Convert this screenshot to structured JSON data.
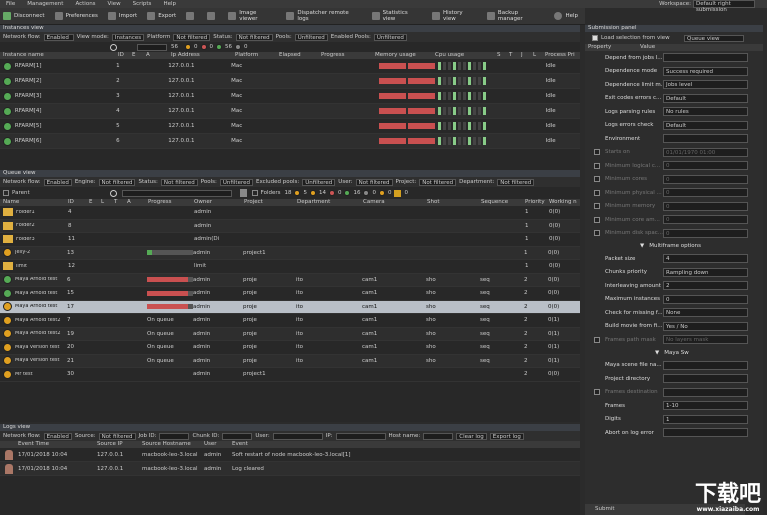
{
  "menu": [
    "File",
    "Management",
    "Actions",
    "View",
    "Scripts",
    "Help"
  ],
  "workspace": {
    "label": "Workspace:",
    "value": "Default right submission"
  },
  "toolbar": [
    "Disconnect",
    "Preferences",
    "Import",
    "Export",
    "",
    "",
    "Image viewer",
    "Dispatcher remote logs",
    "Statistics view",
    "History view",
    "Backup manager",
    "Help"
  ],
  "instances": {
    "title": "Instances view",
    "filter": {
      "network": "Network flow:",
      "network_val": "Enabled",
      "viewmode": "View mode:",
      "viewmode_val": "Instances",
      "platform": "Platform",
      "platform_val": "Not filtered",
      "status": "Status:",
      "status_val": "Not filtered",
      "pools": "Pools:",
      "pools_val": "Unfiltered",
      "enabled_pools": "Enabled Pools:",
      "enabled_val": "Unfiltered"
    },
    "counts": [
      "56",
      "0",
      "0",
      "56",
      "0"
    ],
    "headers": [
      "Instance name",
      "ID",
      "E",
      "A",
      "Ip Address",
      "Platform",
      "Elapsed",
      "Progress",
      "Memory usage",
      "Cpu usage",
      "S",
      "T",
      "J",
      "L",
      "Process Pri"
    ],
    "rows": [
      {
        "name": "RFARM[1]",
        "id": "1",
        "ip": "127.0.0.1",
        "platform": "Mac",
        "prio": "Idle"
      },
      {
        "name": "RFARM[2]",
        "id": "2",
        "ip": "127.0.0.1",
        "platform": "Mac",
        "prio": "Idle"
      },
      {
        "name": "RFARM[3]",
        "id": "3",
        "ip": "127.0.0.1",
        "platform": "Mac",
        "prio": "Idle"
      },
      {
        "name": "RFARM[4]",
        "id": "4",
        "ip": "127.0.0.1",
        "platform": "Mac",
        "prio": "Idle"
      },
      {
        "name": "RFARM[5]",
        "id": "5",
        "ip": "127.0.0.1",
        "platform": "Mac",
        "prio": "Idle"
      },
      {
        "name": "RFARM[6]",
        "id": "6",
        "ip": "127.0.0.1",
        "platform": "Mac",
        "prio": "Idle"
      }
    ]
  },
  "queue": {
    "title": "Queue view",
    "filter": {
      "network": "Network flow:",
      "network_val": "Enabled",
      "engine": "Engine:",
      "engine_val": "Not filtered",
      "status": "Status:",
      "status_val": "Not filtered",
      "pools": "Pools:",
      "pools_val": "Unfiltered",
      "excl": "Excluded pools:",
      "excl_val": "Unfiltered",
      "user": "User:",
      "user_val": "Not filtered",
      "project": "Project:",
      "project_val": "Not filtered",
      "dept": "Department:",
      "dept_val": "Not filtered"
    },
    "parent": "Parent",
    "folders": "Folders",
    "counts": [
      "18",
      "5",
      "14",
      "0",
      "16",
      "0",
      "0",
      "0"
    ],
    "headers": [
      "Name",
      "ID",
      "E",
      "L",
      "T",
      "A",
      "Progress",
      "Owner",
      "Project",
      "Department",
      "Camera",
      "Shot",
      "Sequence",
      "Priority",
      "Working n"
    ],
    "rows": [
      {
        "name": "Folder1",
        "id": "4",
        "progress": "",
        "owner": "admin",
        "project": "",
        "dept": "",
        "camera": "",
        "shot": "",
        "seq": "",
        "prio": "1",
        "work": "0(0)"
      },
      {
        "name": "Folder2",
        "id": "8",
        "progress": "",
        "owner": "admin",
        "project": "",
        "dept": "",
        "camera": "",
        "shot": "",
        "seq": "",
        "prio": "1",
        "work": "0(0)"
      },
      {
        "name": "Folder3",
        "id": "11",
        "progress": "",
        "owner": "admin(Di",
        "project": "",
        "dept": "",
        "camera": "",
        "shot": "",
        "seq": "",
        "prio": "1",
        "work": "0(0)"
      },
      {
        "name": "Jelly-2",
        "id": "13",
        "progress": "",
        "owner": "admin",
        "project": "project1",
        "dept": "",
        "camera": "",
        "shot": "",
        "seq": "",
        "prio": "1",
        "work": "0(0)"
      },
      {
        "name": "limit",
        "id": "12",
        "progress": "",
        "owner": "limit",
        "project": "",
        "dept": "",
        "camera": "",
        "shot": "",
        "seq": "",
        "prio": "1",
        "work": "0(0)"
      },
      {
        "name": "Maya Arnold test",
        "id": "6",
        "progress": "",
        "owner": "admin",
        "project": "proje",
        "dept": "ito",
        "camera": "cam1",
        "shot": "sho",
        "seq": "seq",
        "prio": "2",
        "work": "0(0)"
      },
      {
        "name": "Maya Arnold test",
        "id": "15",
        "progress": "",
        "owner": "admin",
        "project": "proje",
        "dept": "ito",
        "camera": "cam1",
        "shot": "sho",
        "seq": "seq",
        "prio": "2",
        "work": "0(0)"
      },
      {
        "name": "Maya Arnold test",
        "id": "17",
        "progress": "",
        "owner": "admin",
        "project": "proje",
        "dept": "ito",
        "camera": "cam1",
        "shot": "sho",
        "seq": "seq",
        "prio": "2",
        "work": "0(0)"
      },
      {
        "name": "Maya Arnold test2",
        "id": "7",
        "progress": "On queue",
        "owner": "admin",
        "project": "proje",
        "dept": "ito",
        "camera": "cam1",
        "shot": "sho",
        "seq": "seq",
        "prio": "2",
        "work": "0(1)"
      },
      {
        "name": "Maya Arnold test2",
        "id": "19",
        "progress": "On queue",
        "owner": "admin",
        "project": "proje",
        "dept": "ito",
        "camera": "cam1",
        "shot": "sho",
        "seq": "seq",
        "prio": "2",
        "work": "0(1)"
      },
      {
        "name": "Maya version test",
        "id": "20",
        "progress": "On queue",
        "owner": "admin",
        "project": "proje",
        "dept": "ito",
        "camera": "cam1",
        "shot": "sho",
        "seq": "seq",
        "prio": "2",
        "work": "0(1)"
      },
      {
        "name": "Maya version test",
        "id": "21",
        "progress": "On queue",
        "owner": "admin",
        "project": "proje",
        "dept": "ito",
        "camera": "cam1",
        "shot": "sho",
        "seq": "seq",
        "prio": "2",
        "work": "0(1)"
      },
      {
        "name": "Mr test",
        "id": "30",
        "progress": "",
        "owner": "admin",
        "project": "project1",
        "dept": "",
        "camera": "",
        "shot": "",
        "seq": "",
        "prio": "2",
        "work": "0(0)"
      }
    ]
  },
  "logs": {
    "title": "Logs view",
    "filter": {
      "network": "Network flow:",
      "network_val": "Enabled",
      "source": "Source:",
      "source_val": "Not filtered",
      "job": "Job ID:",
      "chunk": "Chunk ID:",
      "user": "User:",
      "ip": "IP:",
      "host": "Host name:",
      "clear": "Clear log",
      "export": "Export log"
    },
    "headers": [
      "Event Time",
      "Source IP",
      "Source Hostname",
      "User",
      "Event"
    ],
    "rows": [
      {
        "time": "17/01/2018 10:04",
        "ip": "127.0.0.1",
        "host": "macbook-leo-3.local",
        "user": "admin",
        "event": "Soft restart of node macbook-leo-3.local[1]"
      },
      {
        "time": "17/01/2018 10:04",
        "ip": "127.0.0.1",
        "host": "macbook-leo-3.local",
        "user": "admin",
        "event": "Log cleared"
      }
    ]
  },
  "submission": {
    "title": "Submission panel",
    "load": "Load selection from view",
    "load_val": "Queue view",
    "cols": [
      "Property",
      "Value"
    ],
    "rows": [
      {
        "label": "Depend from jobs l...",
        "value": ""
      },
      {
        "label": "Dependence mode",
        "value": "Success required"
      },
      {
        "label": "Dependence limit m...",
        "value": "Jobs level"
      },
      {
        "label": "Exit codes errors c...",
        "value": "Default"
      },
      {
        "label": "Logs parsing rules",
        "value": "No rules"
      },
      {
        "label": "Logs errors check",
        "value": "Default"
      },
      {
        "label": "Environment",
        "value": ""
      },
      {
        "label": "Starts on",
        "value": "01/01/1970 01:00"
      },
      {
        "label": "Minimum logical c...",
        "value": "0"
      },
      {
        "label": "Minimum cores",
        "value": "0"
      },
      {
        "label": "Minimum physical ...",
        "value": "0"
      },
      {
        "label": "Minimum memory",
        "value": "0"
      },
      {
        "label": "Minimum core am...",
        "value": "0"
      },
      {
        "label": "Minimum disk spac...",
        "value": "0"
      }
    ],
    "multiframe": "Multiframe options",
    "mrows": [
      {
        "label": "Packet size",
        "value": "4"
      },
      {
        "label": "Chunks priority",
        "value": "Rampling down"
      },
      {
        "label": "Interleaving amount",
        "value": "2"
      },
      {
        "label": "Maximum instances",
        "value": "0"
      },
      {
        "label": "Check for missing f...",
        "value": "None"
      },
      {
        "label": "Build movie from fi...",
        "value": "Yes / No"
      },
      {
        "label": "Frames path mask",
        "value": "No layers mask"
      }
    ],
    "maya": "Maya Sw",
    "yrows": [
      {
        "label": "Maya scene file na...",
        "value": ""
      },
      {
        "label": "Project directory",
        "value": ""
      },
      {
        "label": "Frames destination",
        "value": ""
      },
      {
        "label": "Frames",
        "value": "1-10"
      },
      {
        "label": "Digits",
        "value": "1"
      },
      {
        "label": "Abort on log error",
        "value": ""
      }
    ],
    "submit": "Submit"
  }
}
